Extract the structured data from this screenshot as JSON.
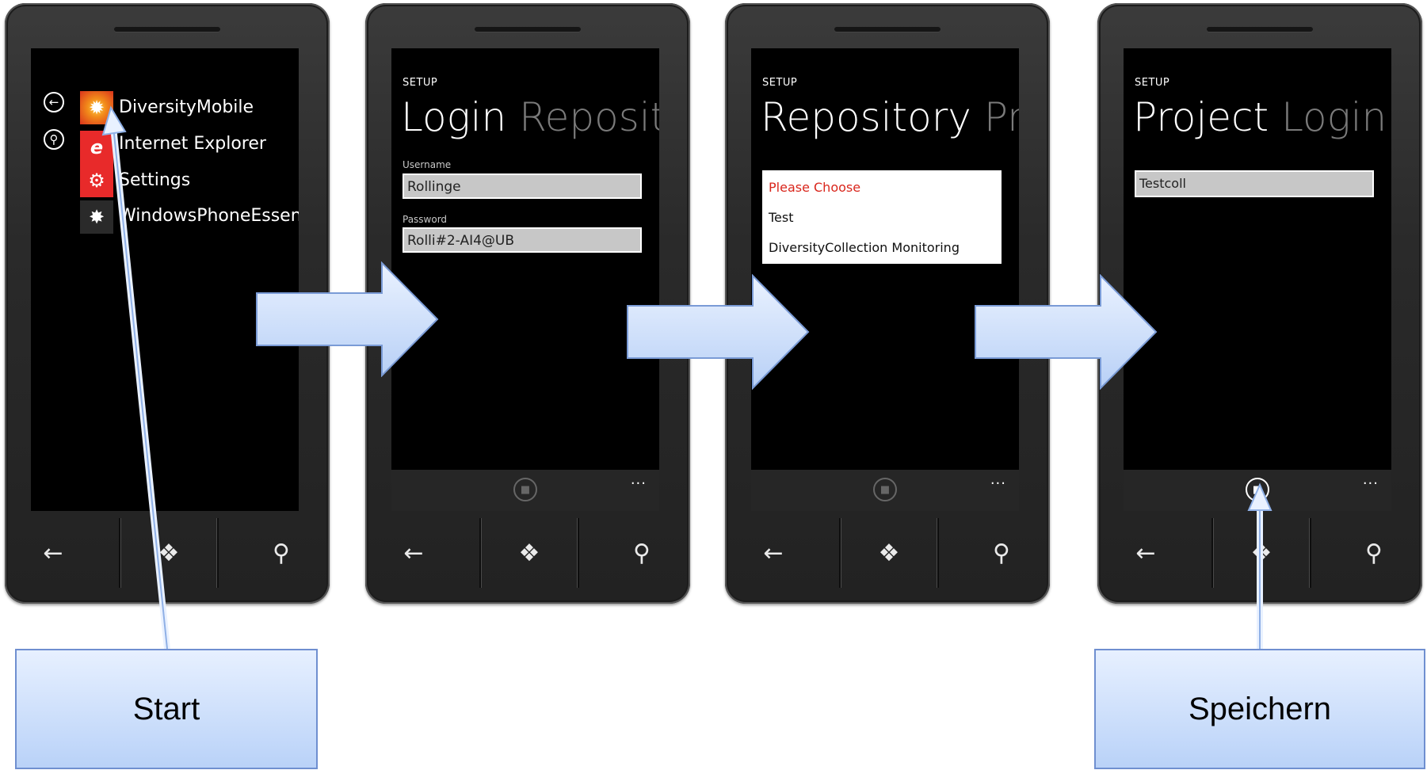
{
  "screen1": {
    "apps": [
      {
        "label": "DiversityMobile",
        "icon": "sunburst-icon",
        "color": "#e03a1e"
      },
      {
        "label": "Internet Explorer",
        "icon": "ie-icon",
        "color": "#e82a2a"
      },
      {
        "label": "Settings",
        "icon": "gear-icon",
        "color": "#e82a2a"
      },
      {
        "label": "WindowsPhoneEssent",
        "icon": "badge-icon",
        "color": "#2a2a2a"
      }
    ]
  },
  "screen2": {
    "setup": "SETUP",
    "title": "Login",
    "next_title": "Reposito",
    "username_label": "Username",
    "username_value": "Rollinge",
    "password_label": "Password",
    "password_value": "Rolli#2-AI4@UB",
    "more": "..."
  },
  "screen3": {
    "setup": "SETUP",
    "title": "Repository",
    "next_title": "Pro",
    "options": [
      "Please Choose",
      "Test",
      "DiversityCollection Monitoring"
    ],
    "highlight_color": "#d9261c",
    "more": "..."
  },
  "screen4": {
    "setup": "SETUP",
    "title": "Project",
    "next_title": "Login R",
    "project_value": "Testcoll",
    "more": "..."
  },
  "callouts": {
    "start": "Start",
    "save": "Speichern"
  }
}
